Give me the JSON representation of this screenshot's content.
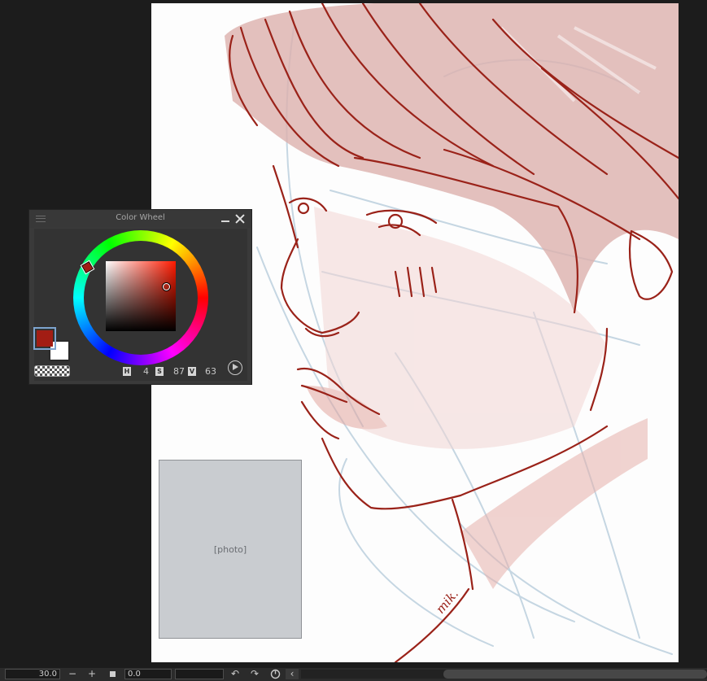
{
  "color_wheel": {
    "title": "Color Wheel",
    "h_label": "H",
    "h_value": "4",
    "s_label": "S",
    "s_value": "87",
    "v_label": "V",
    "v_value": "63",
    "main_color": "#a21d14",
    "sub_color": "#ffffff",
    "hue": 4,
    "saturation": 87,
    "brightness": 63
  },
  "statusbar": {
    "zoom_value": "30.0",
    "zoom_out_label": "−",
    "zoom_in_label": "+",
    "rotation_value": "0.0",
    "rotate_left_icon": "↶",
    "rotate_right_icon": "↷",
    "reset_rotation_icon": "reset-rotation-icon",
    "collapse_icon": "‹"
  },
  "canvas": {
    "artwork": "sketch-portrait",
    "line_color": "#9a2219",
    "fill_color": "#e3b6b0",
    "guide_color": "#b9ccdb",
    "signature": "mik."
  },
  "photo_placeholder": "[photo]"
}
